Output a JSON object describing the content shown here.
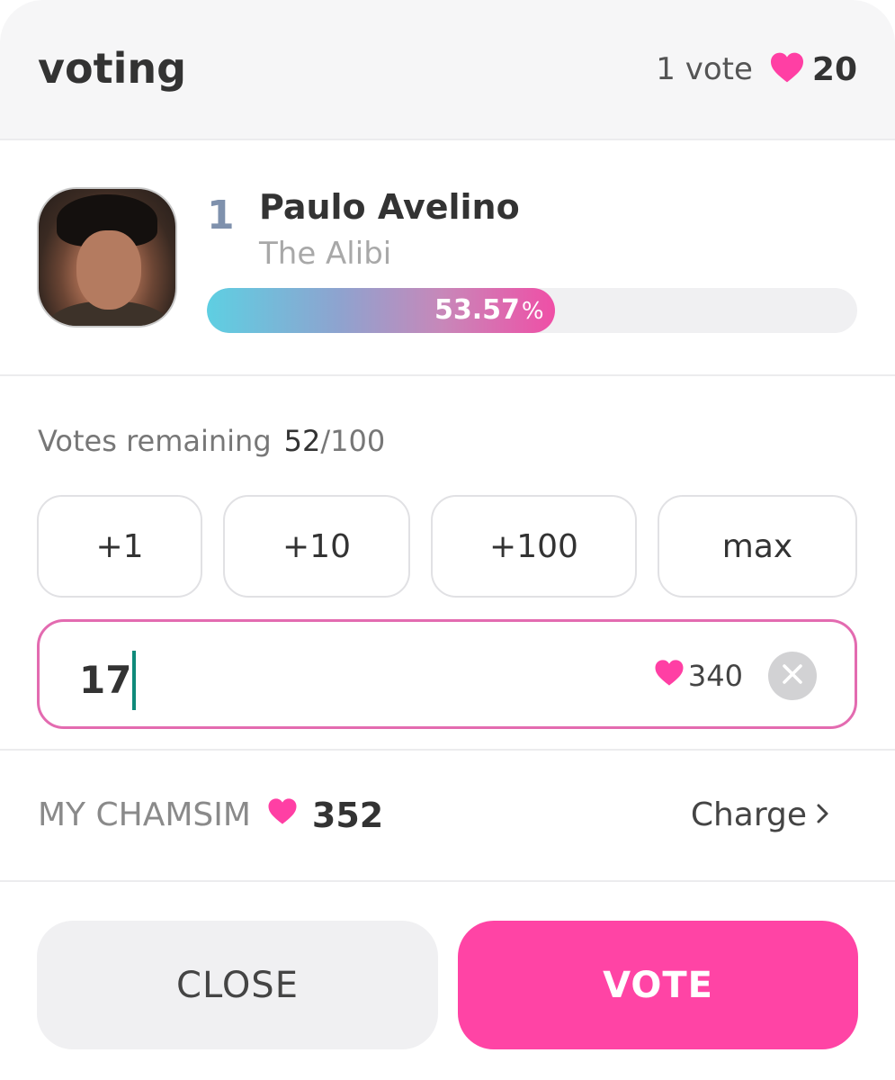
{
  "header": {
    "title": "voting",
    "vote_unit_label": "1 vote",
    "vote_unit_cost": "20"
  },
  "candidate": {
    "rank": "1",
    "name": "Paulo Avelino",
    "subtitle": "The Alibi",
    "vote_share_percent": 53.57,
    "vote_share_value": "53.57",
    "vote_share_unit": "%"
  },
  "remaining": {
    "label": "Votes remaining",
    "count": "52",
    "total": "/100"
  },
  "quick_buttons": [
    "+1",
    "+10",
    "+100",
    "max"
  ],
  "amount_input": {
    "value": "17",
    "cost": "340"
  },
  "wallet": {
    "label": "MY CHAMSIM",
    "amount": "352",
    "charge_label": "Charge"
  },
  "actions": {
    "close_label": "CLOSE",
    "vote_label": "VOTE"
  },
  "colors": {
    "accent_pink": "#ff44a5",
    "heart_pink": "#ff3fa4",
    "input_border": "#e36bb0",
    "progress_start": "#5ecfe2",
    "progress_end": "#ef4fa6",
    "rank_color": "#7f91ad",
    "caret": "#0f8a7a"
  },
  "icons": {
    "header_heart": "heart-icon",
    "input_heart": "heart-icon",
    "wallet_heart": "heart-icon",
    "clear": "close-icon",
    "charge": "chevron-right-icon"
  }
}
